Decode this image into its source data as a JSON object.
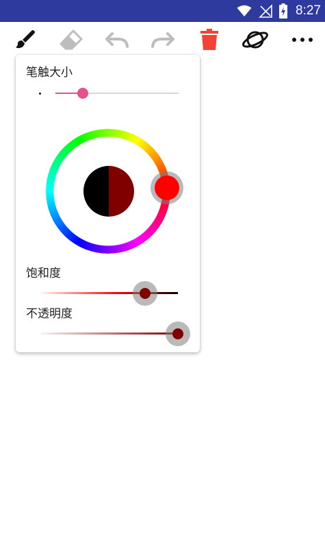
{
  "status_bar": {
    "time": "8:27",
    "background": "#2f3a9e",
    "icons": [
      "wifi-icon",
      "signal-icon",
      "battery-charging-icon"
    ]
  },
  "toolbar": {
    "tools": [
      {
        "name": "brush-icon",
        "active": true
      },
      {
        "name": "eraser-icon",
        "active": false
      },
      {
        "name": "undo-icon",
        "active": false
      },
      {
        "name": "redo-icon",
        "active": false
      },
      {
        "name": "delete-icon",
        "color": "#f44336"
      },
      {
        "name": "planet-icon",
        "active": false
      },
      {
        "name": "more-icon",
        "active": false
      }
    ]
  },
  "brush_panel": {
    "size_label": "笔触大小",
    "size_value": 0.22,
    "size_thumb_color": "#e84f8c",
    "color_wheel": {
      "selected_hue_color": "#ff0000",
      "preview_old_color": "#000000",
      "preview_new_color": "#800000"
    },
    "saturation_label": "饱和度",
    "saturation_value": 0.76,
    "opacity_label": "不透明度",
    "opacity_value": 1.0,
    "current_color": "#800000"
  }
}
